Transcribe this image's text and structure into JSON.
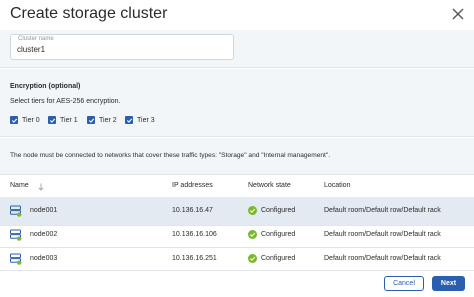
{
  "dialog": {
    "title": "Create storage cluster",
    "close_icon": "close-icon"
  },
  "cluster_name": {
    "label": "Cluster name",
    "value": "cluster1"
  },
  "encryption": {
    "title": "Encryption (optional)",
    "description": "Select tiers for AES-256 encryption.",
    "tiers": [
      {
        "label": "Tier 0",
        "checked": true
      },
      {
        "label": "Tier 1",
        "checked": true
      },
      {
        "label": "Tier 2",
        "checked": true
      },
      {
        "label": "Tier 3",
        "checked": true
      }
    ]
  },
  "network_note": "The node must be connected to networks that cover these traffic types: \"Storage\" and \"Internal management\".",
  "table": {
    "columns": [
      "Name",
      "IP addresses",
      "Network state",
      "Location"
    ],
    "rows": [
      {
        "name": "node001",
        "ip": "10.136.16.47",
        "state": "Configured",
        "location": "Default room/Default row/Default rack"
      },
      {
        "name": "node002",
        "ip": "10.136.16.106",
        "state": "Configured",
        "location": "Default room/Default row/Default rack"
      },
      {
        "name": "node003",
        "ip": "10.136.16.251",
        "state": "Configured",
        "location": "Default room/Default row/Default rack"
      }
    ]
  },
  "footer": {
    "cancel": "Cancel",
    "next": "Next"
  },
  "colors": {
    "accent": "#2a5fb0",
    "status_ok": "#7cb82f",
    "panel": "#f2f6f9",
    "selected_row": "#e3eaf2"
  }
}
